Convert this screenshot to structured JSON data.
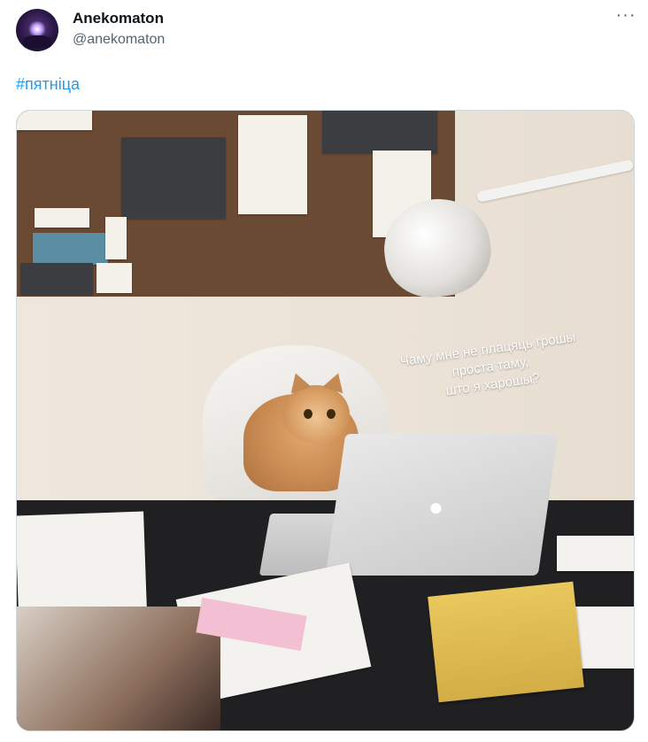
{
  "author": {
    "display_name": "Anekomaton",
    "handle": "@anekomaton",
    "avatar_icon": "avatar-icon"
  },
  "menu": {
    "more_label": "···",
    "more_icon": "more-horizontal-icon"
  },
  "tweet": {
    "hashtag": "#пятніца"
  },
  "media": {
    "caption_lines": [
      "Чаму мне не плацяць грошы",
      "проста таму,",
      "што я харошы?"
    ]
  },
  "colors": {
    "link": "#1d9bf0",
    "secondary_text": "#536471",
    "border": "#cfd9de"
  }
}
